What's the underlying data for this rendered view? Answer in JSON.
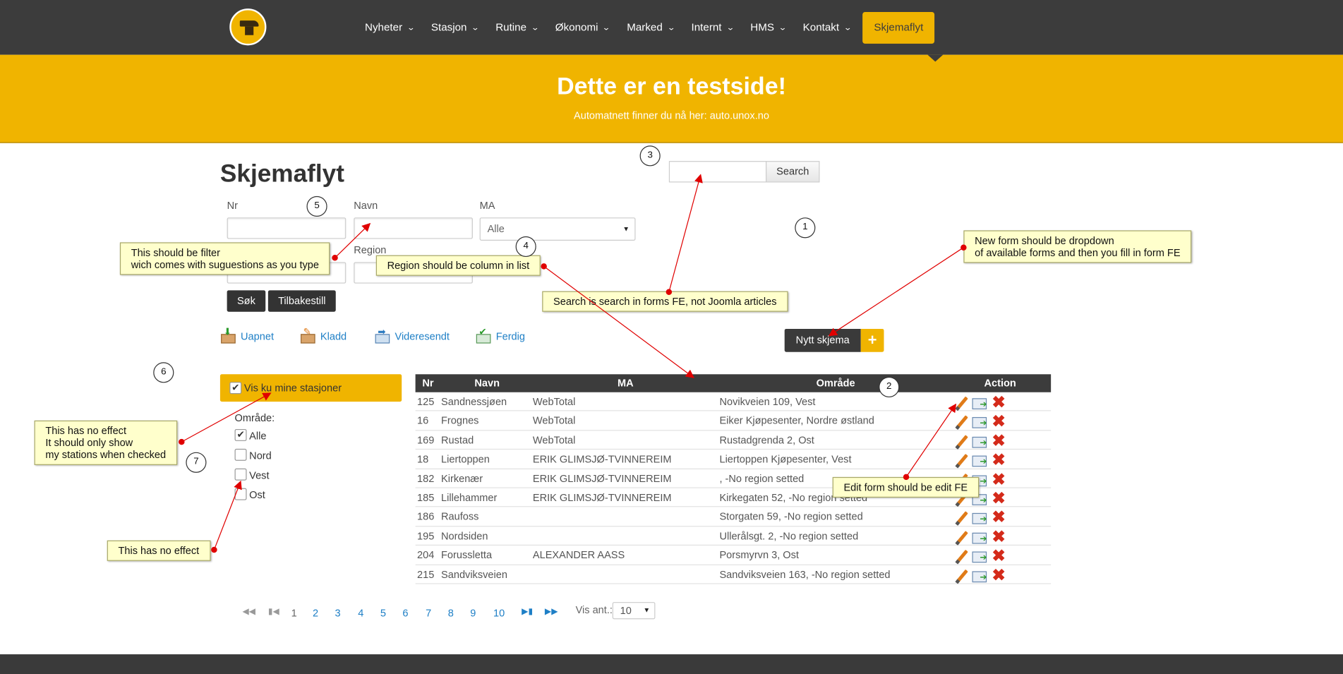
{
  "nav": {
    "items": [
      {
        "label": "Nyheter"
      },
      {
        "label": "Stasjon"
      },
      {
        "label": "Rutine"
      },
      {
        "label": "Økonomi"
      },
      {
        "label": "Marked"
      },
      {
        "label": "Internt"
      },
      {
        "label": "HMS"
      },
      {
        "label": "Kontakt"
      }
    ],
    "active_label": "Skjemaflyt"
  },
  "banner": {
    "title": "Dette er en testside!",
    "subtitle": "Automatnett finner du nå her: auto.unox.no"
  },
  "page": {
    "title": "Skjemaflyt"
  },
  "filters": {
    "nr_label": "Nr",
    "navn_label": "Navn",
    "ma_label": "MA",
    "ma_value": "Alle",
    "region_label": "Region",
    "sok_button": "Søk",
    "reset_button": "Tilbakestill"
  },
  "search": {
    "button": "Search"
  },
  "statuses": {
    "uapnet": "Uapnet",
    "kladd": "Kladd",
    "videresendt": "Videresendt",
    "ferdig": "Ferdig"
  },
  "new_form": {
    "label": "Nytt skjema",
    "plus": "+"
  },
  "sidebar": {
    "vis_mine": "Vis ku mine stasjoner",
    "omrade_label": "Område:",
    "areas": [
      {
        "label": "Alle",
        "checked": true
      },
      {
        "label": "Nord",
        "checked": false
      },
      {
        "label": "Vest",
        "checked": false
      },
      {
        "label": "Ost",
        "checked": false
      }
    ]
  },
  "table": {
    "headers": {
      "nr": "Nr",
      "navn": "Navn",
      "ma": "MA",
      "omrade": "Område",
      "action": "Action"
    },
    "rows": [
      {
        "nr": "125",
        "navn": "Sandnessjøen",
        "ma": "WebTotal",
        "omrade": "Novikveien 109, Vest"
      },
      {
        "nr": "16",
        "navn": "Frognes",
        "ma": "WebTotal",
        "omrade": "Eiker Kjøpesenter, Nordre østland"
      },
      {
        "nr": "169",
        "navn": "Rustad",
        "ma": "WebTotal",
        "omrade": "Rustadgrenda 2, Ost"
      },
      {
        "nr": "18",
        "navn": "Liertoppen",
        "ma": "ERIK GLIMSJØ-TVINNEREIM",
        "omrade": "Liertoppen Kjøpesenter, Vest"
      },
      {
        "nr": "182",
        "navn": "Kirkenær",
        "ma": "ERIK GLIMSJØ-TVINNEREIM",
        "omrade": ", -No region setted"
      },
      {
        "nr": "185",
        "navn": "Lillehammer",
        "ma": "ERIK GLIMSJØ-TVINNEREIM",
        "omrade": "Kirkegaten 52, -No region setted"
      },
      {
        "nr": "186",
        "navn": "Raufoss",
        "ma": "",
        "omrade": "Storgaten 59, -No region setted"
      },
      {
        "nr": "195",
        "navn": "Nordsiden",
        "ma": "",
        "omrade": "Ullerålsgt. 2, -No region setted"
      },
      {
        "nr": "204",
        "navn": "Forussletta",
        "ma": "ALEXANDER AASS",
        "omrade": "Porsmyrvn 3, Ost"
      },
      {
        "nr": "215",
        "navn": "Sandviksveien",
        "ma": "",
        "omrade": "Sandviksveien 163, -No region setted"
      }
    ]
  },
  "pager": {
    "pages": [
      "1",
      "2",
      "3",
      "4",
      "5",
      "6",
      "7",
      "8",
      "9",
      "10"
    ],
    "current": "1",
    "vis_ant_label": "Vis ant.:",
    "vis_ant_value": "10"
  },
  "annotations": {
    "notes": {
      "filter": "This should be filter\nwich comes with suguestions as you type",
      "region": "Region should be column in list",
      "search": "Search is search in forms FE, not Joomla articles",
      "new_form": "New form should be dropdown\nof available forms and then you fill in form FE",
      "my_stations": "This has no effect\nIt should only show\nmy stations when checked",
      "edit": "Edit form should be edit FE",
      "area_effect": "This has no effect"
    },
    "numbers": [
      "1",
      "2",
      "3",
      "4",
      "5",
      "6",
      "7"
    ],
    "color": "#e00000"
  },
  "colors": {
    "accent": "#f0b400",
    "dark": "#3c3c3c",
    "link": "#1e7fc6",
    "delete": "#d42a1a"
  }
}
